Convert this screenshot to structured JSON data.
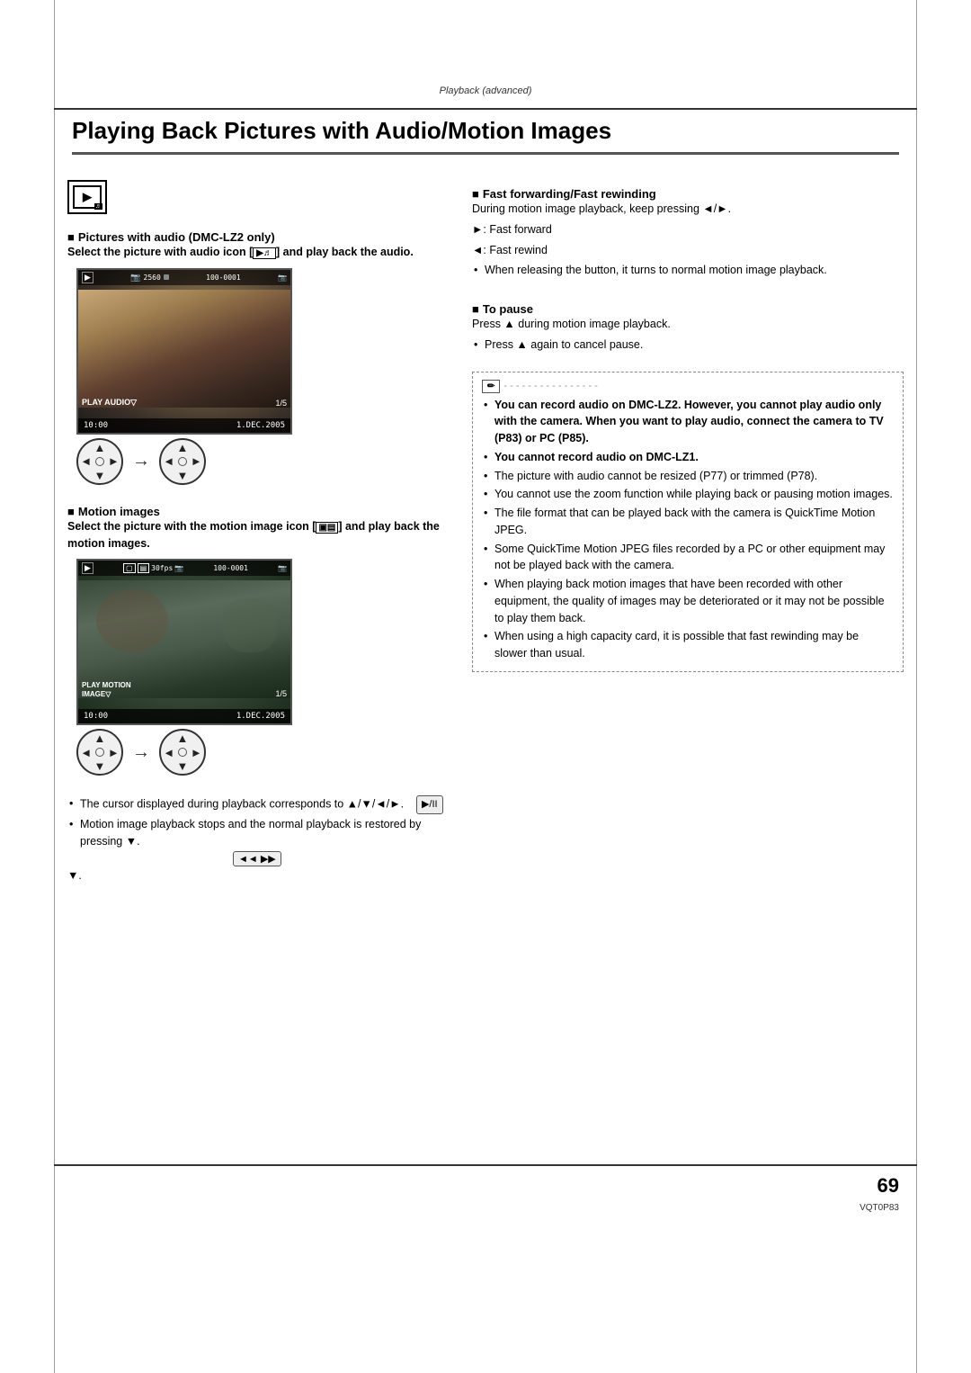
{
  "page": {
    "subtitle": "Playback (advanced)",
    "title": "Playing Back Pictures with Audio/Motion Images",
    "page_number": "69",
    "product_code": "VQT0P83"
  },
  "left_column": {
    "audio_section": {
      "header": "Pictures with audio (DMC-LZ2 only)",
      "body_line1": "Select the picture with audio icon [",
      "body_line2": "] and play back the audio.",
      "screen": {
        "resolution": "2560",
        "counter": "100-0001",
        "label": "PLAY AUDIO▽",
        "fraction": "1/5",
        "time": "10:00",
        "date": "1.DEC.2005"
      }
    },
    "motion_section": {
      "header": "Motion images",
      "body_bold": "Select the picture with the motion image icon [",
      "body_bold2": "] and play back the motion images.",
      "screen": {
        "fps": "30fps",
        "counter": "100-0001",
        "label": "PLAY MOTION IMAGE▽",
        "fraction": "1/5",
        "time": "10:00",
        "date": "1.DEC.2005"
      }
    },
    "cursor_note1": "The cursor displayed during playback corresponds to ▲/▼/◄/►.",
    "cursor_note2": "Motion image playback stops and the normal playback is restored by pressing ▼."
  },
  "right_column": {
    "fast_forward_section": {
      "header": "Fast forwarding/Fast rewinding",
      "intro": "During motion image playback, keep pressing ◄/►.",
      "items": [
        "►:  Fast forward",
        "◄:  Fast rewind"
      ],
      "note": "When releasing the button, it turns to normal motion image playback."
    },
    "pause_section": {
      "header": "To pause",
      "line1": "Press ▲ during motion image playback.",
      "line2": "Press ▲ again to cancel pause."
    },
    "note_box": {
      "items": [
        "You can record audio on DMC-LZ2. However, you cannot play audio only with the camera. When you want to play audio, connect the camera to TV (P83) or PC (P85).",
        "You cannot record audio on DMC-LZ1.",
        "The picture with audio cannot be resized (P77) or trimmed (P78).",
        "You cannot use the zoom function while playing back or pausing motion images.",
        "The file format that can be played back with the camera is QuickTime Motion JPEG.",
        "Some QuickTime Motion JPEG files recorded by a PC or other equipment may not be played back with the camera.",
        "When playing back motion images that have been recorded with other equipment, the quality of images may be deteriorated or it may not be possible to play them back.",
        "When using a high capacity card, it is possible that fast rewinding may be slower than usual."
      ]
    }
  }
}
